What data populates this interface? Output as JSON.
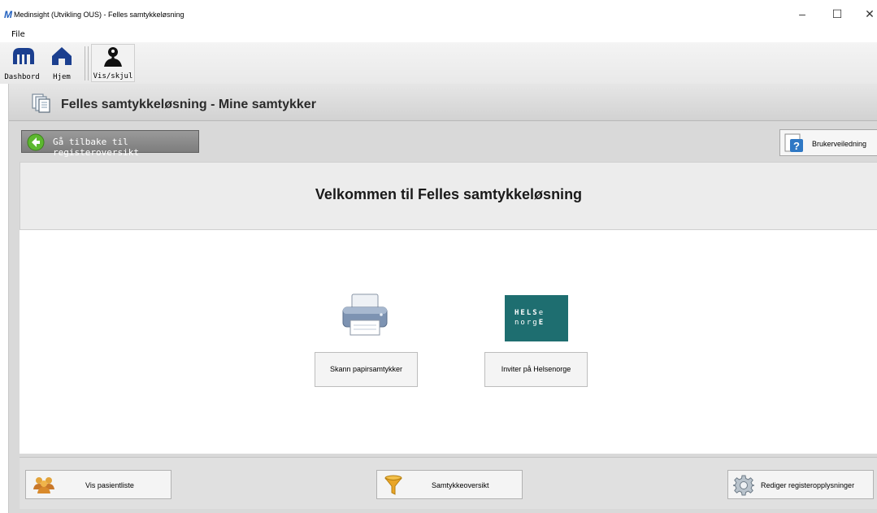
{
  "window": {
    "title": "Medinsight (Utvikling OUS) - Felles samtykkeløsning",
    "logo_text": "M",
    "minimize_glyph": "–",
    "maximize_glyph": "☐",
    "close_glyph": "✕"
  },
  "menu": {
    "file": "File"
  },
  "toolbar": {
    "dashboard": {
      "label": "Dashbord",
      "icon": "dashboard-icon"
    },
    "home": {
      "label": "Hjem",
      "icon": "home-icon"
    },
    "toggle": {
      "label": "Vis/skjul",
      "icon": "person-icon"
    }
  },
  "module": {
    "title": "Felles samtykkeløsning - Mine samtykker",
    "back_label": "Gå tilbake til registeroversikt",
    "help_label": "Brukerveiledning"
  },
  "welcome": "Velkommen til Felles samtykkeløsning",
  "actions": {
    "scan_label": "Skann papirsamtykker",
    "invite_label": "Inviter på Helsenorge",
    "helsenorge_logo": {
      "line1_bold": "HELS",
      "line1_light": "e",
      "line2_light": "norg",
      "line2_bold": "E"
    }
  },
  "bottom": {
    "patient_list_label": "Vis pasientliste",
    "consent_overview_label": "Samtykkeoversikt",
    "edit_register_label": "Rediger registeropplysninger"
  },
  "colors": {
    "helsenorge_teal": "#1e6e70",
    "back_button_green": "#5cb82f",
    "toolbar_icon_blue": "#1b3f8f"
  }
}
